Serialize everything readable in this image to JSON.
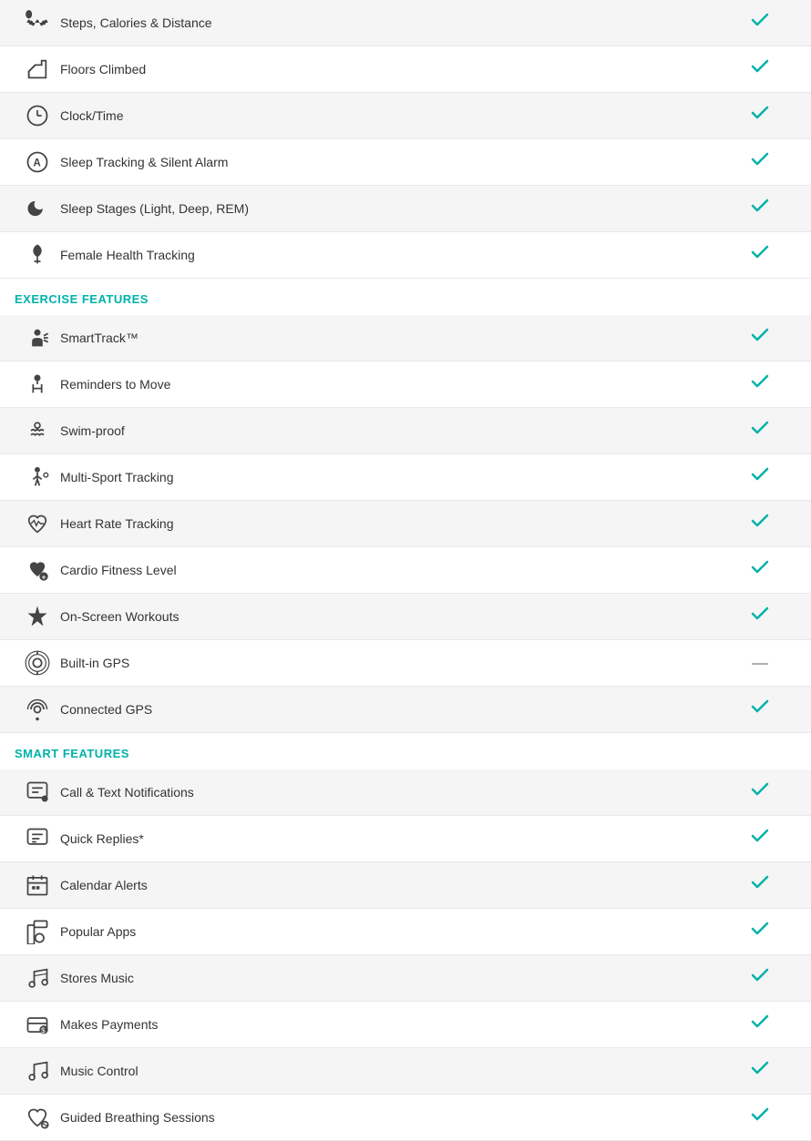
{
  "sections": [
    {
      "type": "rows",
      "rows": [
        {
          "id": "steps",
          "label": "Steps, Calories & Distance",
          "check": true,
          "icon": "activity"
        },
        {
          "id": "floors",
          "label": "Floors Climbed",
          "check": true,
          "icon": "floors"
        },
        {
          "id": "clock",
          "label": "Clock/Time",
          "check": true,
          "icon": "clock"
        },
        {
          "id": "sleep-tracking",
          "label": "Sleep Tracking & Silent Alarm",
          "check": true,
          "icon": "sleep-a"
        },
        {
          "id": "sleep-stages",
          "label": "Sleep Stages (Light, Deep, REM)",
          "check": true,
          "icon": "sleep-moon"
        },
        {
          "id": "female-health",
          "label": "Female Health Tracking",
          "check": true,
          "icon": "female"
        }
      ]
    },
    {
      "type": "header",
      "label": "EXERCISE FEATURES"
    },
    {
      "type": "rows",
      "rows": [
        {
          "id": "smarttrack",
          "label": "SmartTrack™",
          "check": true,
          "icon": "smarttrack"
        },
        {
          "id": "reminders",
          "label": "Reminders to Move",
          "check": true,
          "icon": "reminders"
        },
        {
          "id": "swim",
          "label": "Swim-proof",
          "check": true,
          "icon": "swim"
        },
        {
          "id": "multisport",
          "label": "Multi-Sport Tracking",
          "check": true,
          "icon": "multisport"
        },
        {
          "id": "heartrate",
          "label": "Heart Rate Tracking",
          "check": true,
          "icon": "heartrate"
        },
        {
          "id": "cardio",
          "label": "Cardio Fitness Level",
          "check": true,
          "icon": "cardio"
        },
        {
          "id": "onscreen",
          "label": "On-Screen Workouts",
          "check": true,
          "icon": "onscreen"
        },
        {
          "id": "builtin-gps",
          "label": "Built-in GPS",
          "check": false,
          "icon": "gps"
        },
        {
          "id": "connected-gps",
          "label": "Connected GPS",
          "check": true,
          "icon": "connected-gps"
        }
      ]
    },
    {
      "type": "header",
      "label": "SMART FEATURES"
    },
    {
      "type": "rows",
      "rows": [
        {
          "id": "call-text",
          "label": "Call & Text Notifications",
          "check": true,
          "icon": "notifications"
        },
        {
          "id": "quick-replies",
          "label": "Quick Replies*",
          "check": true,
          "icon": "quick-replies"
        },
        {
          "id": "calendar",
          "label": "Calendar Alerts",
          "check": true,
          "icon": "calendar"
        },
        {
          "id": "popular-apps",
          "label": "Popular Apps",
          "check": true,
          "icon": "apps"
        },
        {
          "id": "stores-music",
          "label": "Stores Music",
          "check": true,
          "icon": "music-store"
        },
        {
          "id": "payments",
          "label": "Makes Payments",
          "check": true,
          "icon": "payments"
        },
        {
          "id": "music-control",
          "label": "Music Control",
          "check": true,
          "icon": "music-control"
        },
        {
          "id": "breathing",
          "label": "Guided Breathing Sessions",
          "check": true,
          "icon": "breathing"
        }
      ]
    }
  ],
  "icons": {
    "check": "✓",
    "dash": "—"
  },
  "colors": {
    "teal": "#00b2a9",
    "header_text": "#00b2a9"
  }
}
